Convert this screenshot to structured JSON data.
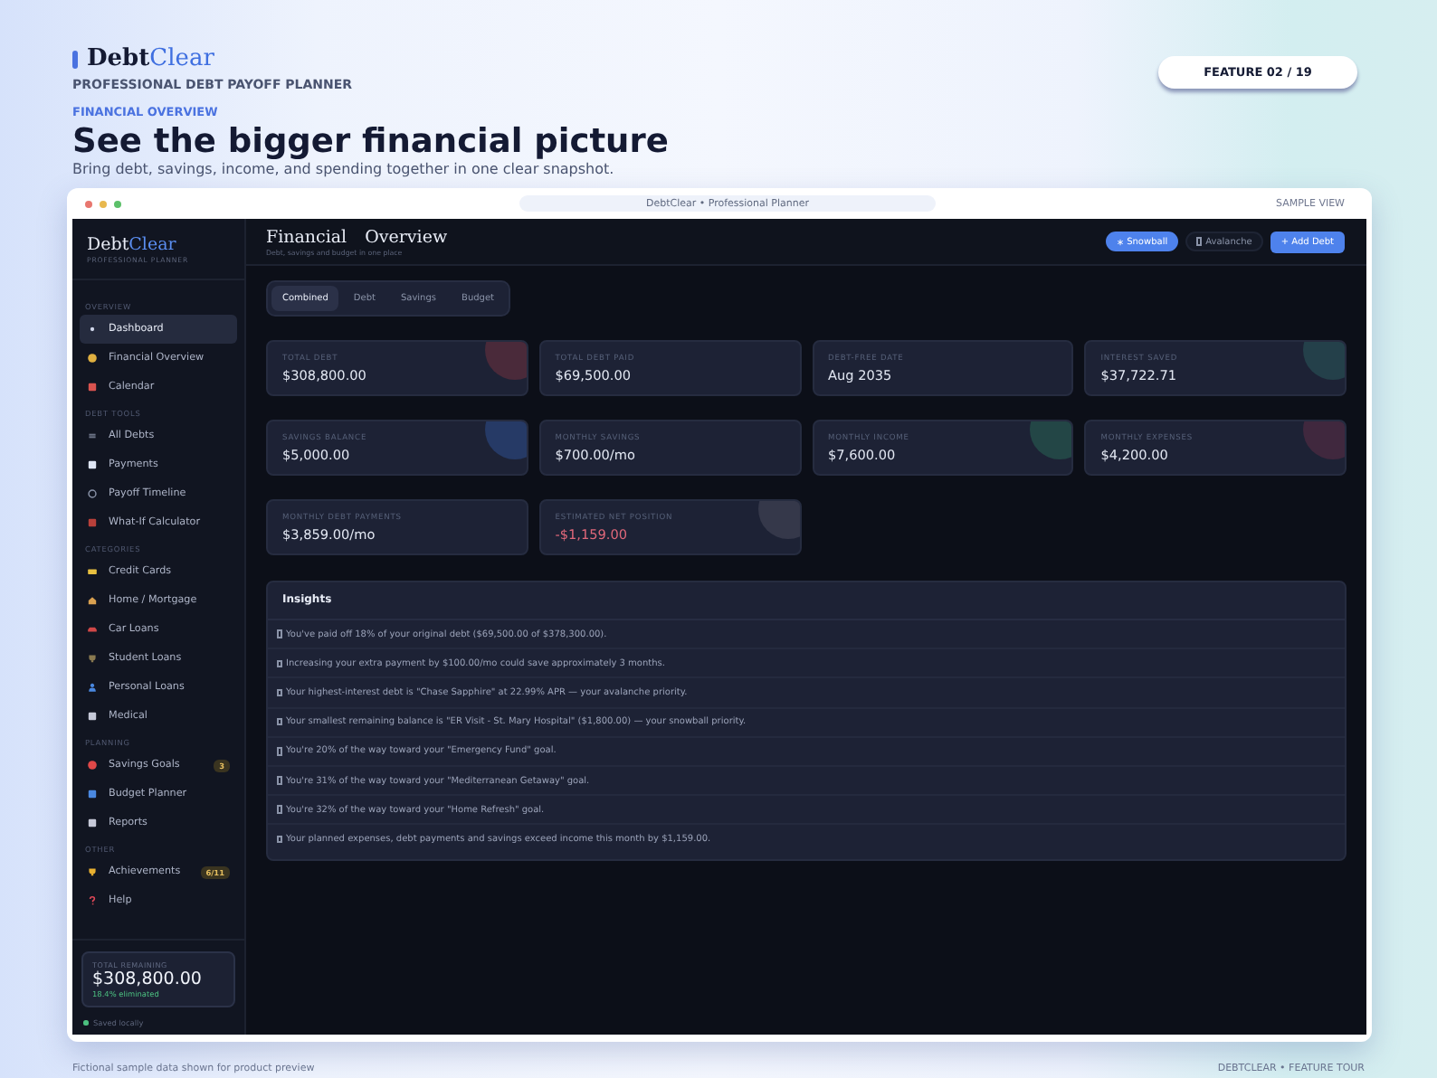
{
  "brand": {
    "part_1": "Debt",
    "part_2": "Clear",
    "tagline": "PROFESSIONAL DEBT PAYOFF PLANNER"
  },
  "feature": {
    "eyebrow": "FINANCIAL OVERVIEW",
    "title": "See the bigger financial picture",
    "subtitle": "Bring debt, savings, income, and spending together in one clear snapshot.",
    "counter": "FEATURE 02 / 19"
  },
  "window": {
    "address": "DebtClear  •  Professional Planner",
    "label": "SAMPLE VIEW"
  },
  "sidebar": {
    "logo": {
      "part_1": "Debt",
      "part_2": "Clear",
      "tagline": "PROFESSIONAL PLANNER"
    },
    "sections": [
      {
        "title": "OVERVIEW",
        "items": [
          {
            "label": "Dashboard",
            "selected": true
          },
          {
            "label": "Financial Overview",
            "selected": false
          },
          {
            "label": "Calendar",
            "selected": false
          }
        ]
      },
      {
        "title": "DEBT TOOLS",
        "items": [
          {
            "label": "All Debts",
            "selected": false
          },
          {
            "label": "Payments",
            "selected": false
          },
          {
            "label": "Payoff Timeline",
            "selected": false
          },
          {
            "label": "What-If Calculator",
            "selected": false
          }
        ]
      },
      {
        "title": "CATEGORIES",
        "items": [
          {
            "label": "Credit Cards",
            "selected": false
          },
          {
            "label": "Home / Mortgage",
            "selected": false
          },
          {
            "label": "Car Loans",
            "selected": false
          },
          {
            "label": "Student Loans",
            "selected": false
          },
          {
            "label": "Personal Loans",
            "selected": false
          },
          {
            "label": "Medical",
            "selected": false
          }
        ]
      },
      {
        "title": "PLANNING",
        "items": [
          {
            "label": "Savings Goals",
            "selected": false,
            "badge": "3"
          },
          {
            "label": "Budget Planner",
            "selected": false
          },
          {
            "label": "Reports",
            "selected": false
          }
        ]
      },
      {
        "title": "OTHER",
        "items": [
          {
            "label": "Achievements",
            "selected": false,
            "badge": "6/11"
          },
          {
            "label": "Help",
            "selected": false
          }
        ]
      }
    ],
    "summary": {
      "label": "TOTAL REMAINING",
      "value": "$308,800.00",
      "note": "18.4% eliminated"
    },
    "status": "Saved locally"
  },
  "main": {
    "title": "Financial Overview",
    "subtitle": "Debt, savings and budget in one place",
    "strategies": [
      {
        "label": "Snowball",
        "selected": true
      },
      {
        "label": "Avalanche",
        "selected": false
      }
    ],
    "add_button": "+ Add Debt",
    "tabs": [
      {
        "label": "Combined",
        "selected": true
      },
      {
        "label": "Debt",
        "selected": false
      },
      {
        "label": "Savings",
        "selected": false
      },
      {
        "label": "Budget",
        "selected": false
      }
    ],
    "stats": [
      {
        "label": "TOTAL DEBT",
        "value": "$308,800.00",
        "negative": false,
        "color": "#4a2a3a"
      },
      {
        "label": "TOTAL DEBT PAID",
        "value": "$69,500.00",
        "negative": false
      },
      {
        "label": "DEBT-FREE DATE",
        "value": "Aug 2035",
        "negative": false
      },
      {
        "label": "INTEREST SAVED",
        "value": "$37,722.71",
        "negative": false,
        "color": "#24404a"
      },
      {
        "label": "SAVINGS BALANCE",
        "value": "$5,000.00",
        "negative": false,
        "color": "#263a66"
      },
      {
        "label": "MONTHLY SAVINGS",
        "value": "$700.00/mo",
        "negative": false
      },
      {
        "label": "MONTHLY INCOME",
        "value": "$7,600.00",
        "negative": false,
        "color": "#234646"
      },
      {
        "label": "MONTHLY EXPENSES",
        "value": "$4,200.00",
        "negative": false,
        "color": "#40283e"
      },
      {
        "label": "MONTHLY DEBT PAYMENTS",
        "value": "$3,859.00/mo",
        "negative": false
      },
      {
        "label": "ESTIMATED NET POSITION",
        "value": "-$1,159.00",
        "negative": true,
        "color": "#35384a"
      }
    ],
    "insights": {
      "title": "Insights",
      "items": [
        "You've paid off 18% of your original debt ($69,500.00 of $378,300.00).",
        "Increasing your extra payment by $100.00/mo could save approximately 3 months.",
        "Your highest-interest debt is \"Chase Sapphire\" at 22.99% APR — your avalanche priority.",
        "Your smallest remaining balance is \"ER Visit - St. Mary Hospital\" ($1,800.00) — your snowball priority.",
        "You're 20% of the way toward your \"Emergency Fund\" goal.",
        "You're 31% of the way toward your \"Mediterranean Getaway\" goal.",
        "You're 32% of the way toward your \"Home Refresh\" goal.",
        "Your planned expenses, debt payments and savings exceed income this month by $1,159.00."
      ]
    }
  },
  "footer": {
    "left": "Fictional sample data shown for product preview",
    "right": "DEBTCLEAR  •  FEATURE TOUR"
  }
}
